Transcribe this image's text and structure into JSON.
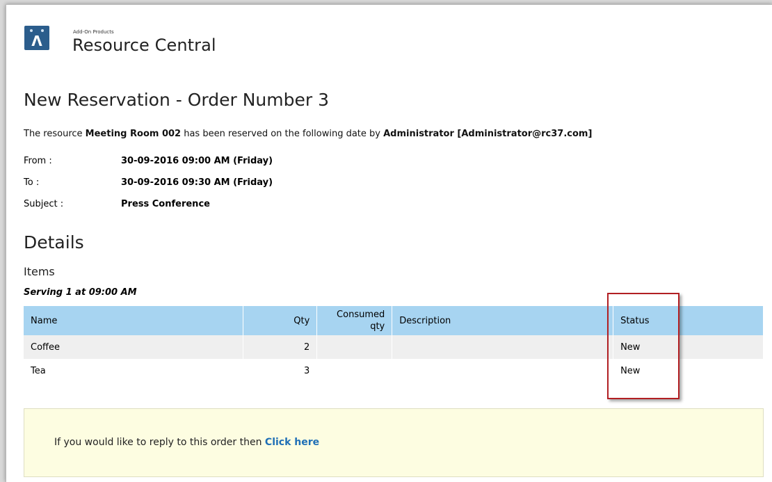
{
  "brand": {
    "small_text": "Add-On Products",
    "name": "Resource Central",
    "logo_color": "#2b5d8c"
  },
  "heading": "New Reservation - Order Number 3",
  "intro": {
    "prefix": "The resource ",
    "resource": "Meeting Room 002",
    "middle": " has been reserved on the following date by ",
    "user": "Administrator [Administrator@rc37.com]"
  },
  "fields": {
    "from_label": "From :",
    "from_value": "30-09-2016 09:00 AM (Friday)",
    "to_label": "To :",
    "to_value": "30-09-2016 09:30 AM (Friday)",
    "subject_label": "Subject :",
    "subject_value": "Press Conference"
  },
  "details_heading": "Details",
  "items_heading": "Items",
  "serving_label": "Serving 1 at 09:00 AM",
  "table": {
    "columns": {
      "name": "Name",
      "qty": "Qty",
      "consumed_line1": "Consumed",
      "consumed_line2": "qty",
      "description": "Description",
      "status": "Status"
    },
    "rows": [
      {
        "name": "Coffee",
        "qty": "2",
        "consumed": "",
        "description": "",
        "status": "New"
      },
      {
        "name": "Tea",
        "qty": "3",
        "consumed": "",
        "description": "",
        "status": "New"
      }
    ]
  },
  "reply": {
    "text": "If you would like to reply to this order then ",
    "link": "Click here"
  },
  "colors": {
    "table_header": "#a7d4f1",
    "highlight_border": "#b21f23",
    "reply_background": "#fdfde1",
    "link": "#1f6fb6"
  }
}
